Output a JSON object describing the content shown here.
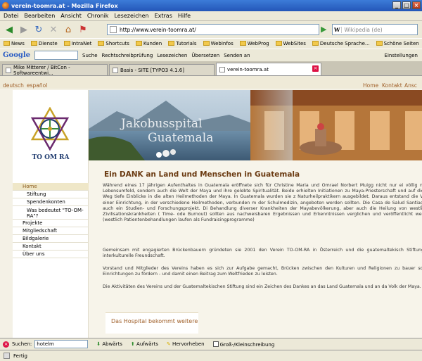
{
  "window": {
    "title": "verein-toomra.at - Mozilla Firefox"
  },
  "menubar": [
    "Datei",
    "Bearbeiten",
    "Ansicht",
    "Chronik",
    "Lesezeichen",
    "Extras",
    "Hilfe"
  ],
  "navigation": {
    "url": "http://www.verein-toomra.at/",
    "search_placeholder": "Wikipedia (de)",
    "search_engine_letter": "W"
  },
  "bookmarks": [
    "News",
    "Dienste",
    "IntraNet",
    "Shortcuts",
    "Kunden",
    "Tutorials",
    "WebInfos",
    "WebProg",
    "WebSites",
    "Deutsche Sprache...",
    "Schöne Seiten"
  ],
  "google_toolbar": {
    "logo": "Google",
    "search_label": "Suche",
    "spell_label": "Rechtschreibprüfung",
    "bookmarks_label": "Lesezeichen",
    "translate_label": "Übersetzen",
    "send_label": "Senden an",
    "settings_label": "Einstellungen"
  },
  "tabs": [
    {
      "title": "Mike Mitterer / BitCon - Softwareentwi..."
    },
    {
      "title": "Basis - SITE [TYPO3 4.1.6]"
    },
    {
      "title": "verein-toomra.at",
      "active": true
    }
  ],
  "page": {
    "languages": [
      "deutsch",
      "español"
    ],
    "top_nav": [
      "Home",
      "Kontakt",
      "Ansc"
    ],
    "logo_text": "TO OM RA",
    "header_text_line1": "Jakobusspital",
    "header_text_line2": "Guatemala",
    "menu": [
      {
        "label": "Home",
        "level": "top",
        "active": true
      },
      {
        "label": "Stiftung",
        "level": "sub"
      },
      {
        "label": "Spendenkonten",
        "level": "sub"
      },
      {
        "label": "Was bedeutet \"TO-OM-RA\"?",
        "level": "sub"
      },
      {
        "label": "Projekte",
        "level": "top"
      },
      {
        "label": "Mitgliedschaft",
        "level": "top"
      },
      {
        "label": "Bildgalerie",
        "level": "top"
      },
      {
        "label": "Kontakt",
        "level": "top"
      },
      {
        "label": "Über uns",
        "level": "top"
      }
    ],
    "heading": "Ein DANK an Land und Menschen in Guatemala",
    "paragraphs": [
      "Während eines 17 jährigen Aufenthaltes in Guatemala eröffnete sich für Christine Maria und Omrael Norbert Muigg nicht nur ei völlig neues Lebensumfeld, sondern auch die Welt der Maya und ihre gelebte Spiritualität. Beide erhielten Initiationen zu Maya-Priesterschaft und auf diesem Weg tiefe Einblicke in die alten Heilmethoden der Maya. In Guatemala wurden sie z Naturheilpraktikern ausgebildet. Daraus entstand die Vision einer Einrichtung, in der verschiedene Heilmethoden, verbunden m der Schulmedizin, angeboten werden sollten. Die Casa de Salud Santiago ist auch ein Studien- und Forschungsprojekt. Di Behandlung diverser Krankheiten der Mayabevölkerung, aber auch die Heilung von westlichen Zivilisationskrankheiten ( Time- ode Burnout) sollten aus nachweisbaren Ergebnissen und Erkenntnissen verglichen und veröffentlicht werden. (westlich Patientenbehandlungen laufen als Fundraisingprogramme)",
      "Gemeinsam mit engagierten Brückenbauern gründeten sie 2001 den Verein TO-OM-RA in Österreich und die guatemaltekisch Stiftung für interkulturelle Freundschaft.",
      "Vorstand und Mitglieder des Vereins haben es sich zur Aufgabe gemacht, Brücken zwischen den Kulturen und Religionen zu bauer soziale Einrichtungen zu fördern - und damit einen Beitrag zum Weltfrieden zu leisten.",
      "Die Aktivitäten des Vereins und der Guatemaltekischen Stiftung sind ein Zeichen des Dankes an das Land Guatemala und an da Volk der Maya."
    ],
    "box_title": "Das Hospital bekommt weitere"
  },
  "findbar": {
    "label": "Suchen:",
    "value": "hotelm",
    "down_label": "Abwärts",
    "up_label": "Aufwärts",
    "highlight_label": "Hervorheben",
    "case_label": "Groß-/Kleinschreibung"
  },
  "status": {
    "text": "Fertig"
  }
}
